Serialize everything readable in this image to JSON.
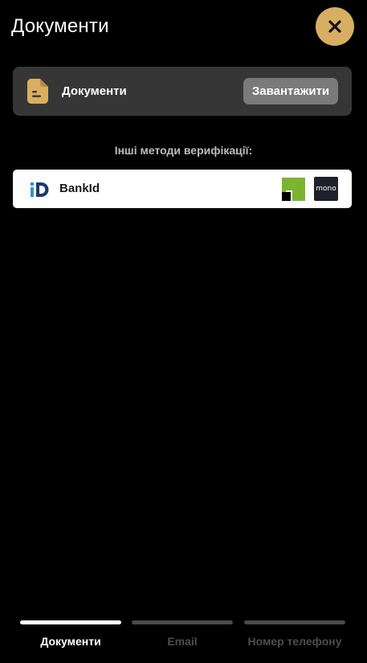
{
  "header": {
    "title": "Документи",
    "close_icon": "close-icon"
  },
  "document_card": {
    "icon": "document-icon",
    "label": "Документи",
    "upload_label": "Завантажити"
  },
  "other_methods": {
    "heading": "Інші методи верифікації:",
    "bankid": {
      "logo_text": "iD",
      "label": "BankId",
      "bank_logos": [
        {
          "name": "privatbank-logo",
          "color": "#7cb432"
        },
        {
          "name": "monobank-logo",
          "text": "mono"
        }
      ]
    }
  },
  "tabs": [
    {
      "label": "Документи",
      "active": true
    },
    {
      "label": "Email",
      "active": false
    },
    {
      "label": "Номер телефону",
      "active": false
    }
  ],
  "colors": {
    "background": "#000000",
    "accent": "#d8ae62",
    "card": "#363636",
    "button": "#7a7a7a"
  }
}
